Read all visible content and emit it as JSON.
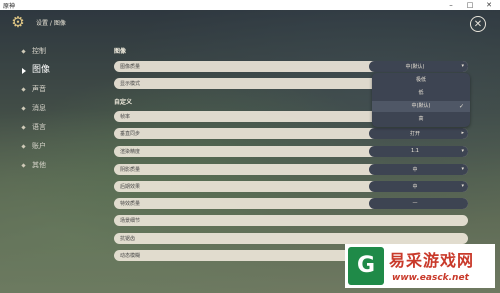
{
  "window": {
    "title": "原神",
    "min": "–",
    "max": "□",
    "close": "✕"
  },
  "header": {
    "breadcrumb": "设置 / 图像",
    "gear_icon": "gear-icon",
    "close_icon": "close-icon"
  },
  "sidebar": {
    "items": [
      {
        "label": "控制",
        "active": false
      },
      {
        "label": "图像",
        "active": true
      },
      {
        "label": "声音",
        "active": false
      },
      {
        "label": "消息",
        "active": false
      },
      {
        "label": "语言",
        "active": false
      },
      {
        "label": "账户",
        "active": false
      },
      {
        "label": "其他",
        "active": false
      }
    ]
  },
  "sections": {
    "image": "图像",
    "custom": "自定义"
  },
  "rows": [
    {
      "label": "图像质量",
      "value": "中(默认)",
      "arrow": "▾"
    },
    {
      "label": "显示模式",
      "value": "",
      "arrow": ""
    },
    {
      "label": "帧率",
      "value": "",
      "arrow": ""
    },
    {
      "label": "垂直同步",
      "value": "打开",
      "arrow": "▸"
    },
    {
      "label": "渲染精度",
      "value": "1.1",
      "arrow": "▾"
    },
    {
      "label": "阴影质量",
      "value": "中",
      "arrow": "▾"
    },
    {
      "label": "后期效果",
      "value": "中",
      "arrow": "▾"
    },
    {
      "label": "特效质量",
      "value": "—",
      "arrow": ""
    },
    {
      "label": "场景细节",
      "value": "",
      "arrow": ""
    },
    {
      "label": "抗锯齿",
      "value": "",
      "arrow": ""
    },
    {
      "label": "动态模糊",
      "value": "",
      "arrow": ""
    }
  ],
  "dropdown": {
    "options": [
      "极低",
      "低",
      "中(默认)",
      "高"
    ],
    "selected_index": 2,
    "check": "✓"
  },
  "watermark": {
    "title": "易采游戏网",
    "url": "www.easck.net",
    "logo_glyph": "G"
  }
}
